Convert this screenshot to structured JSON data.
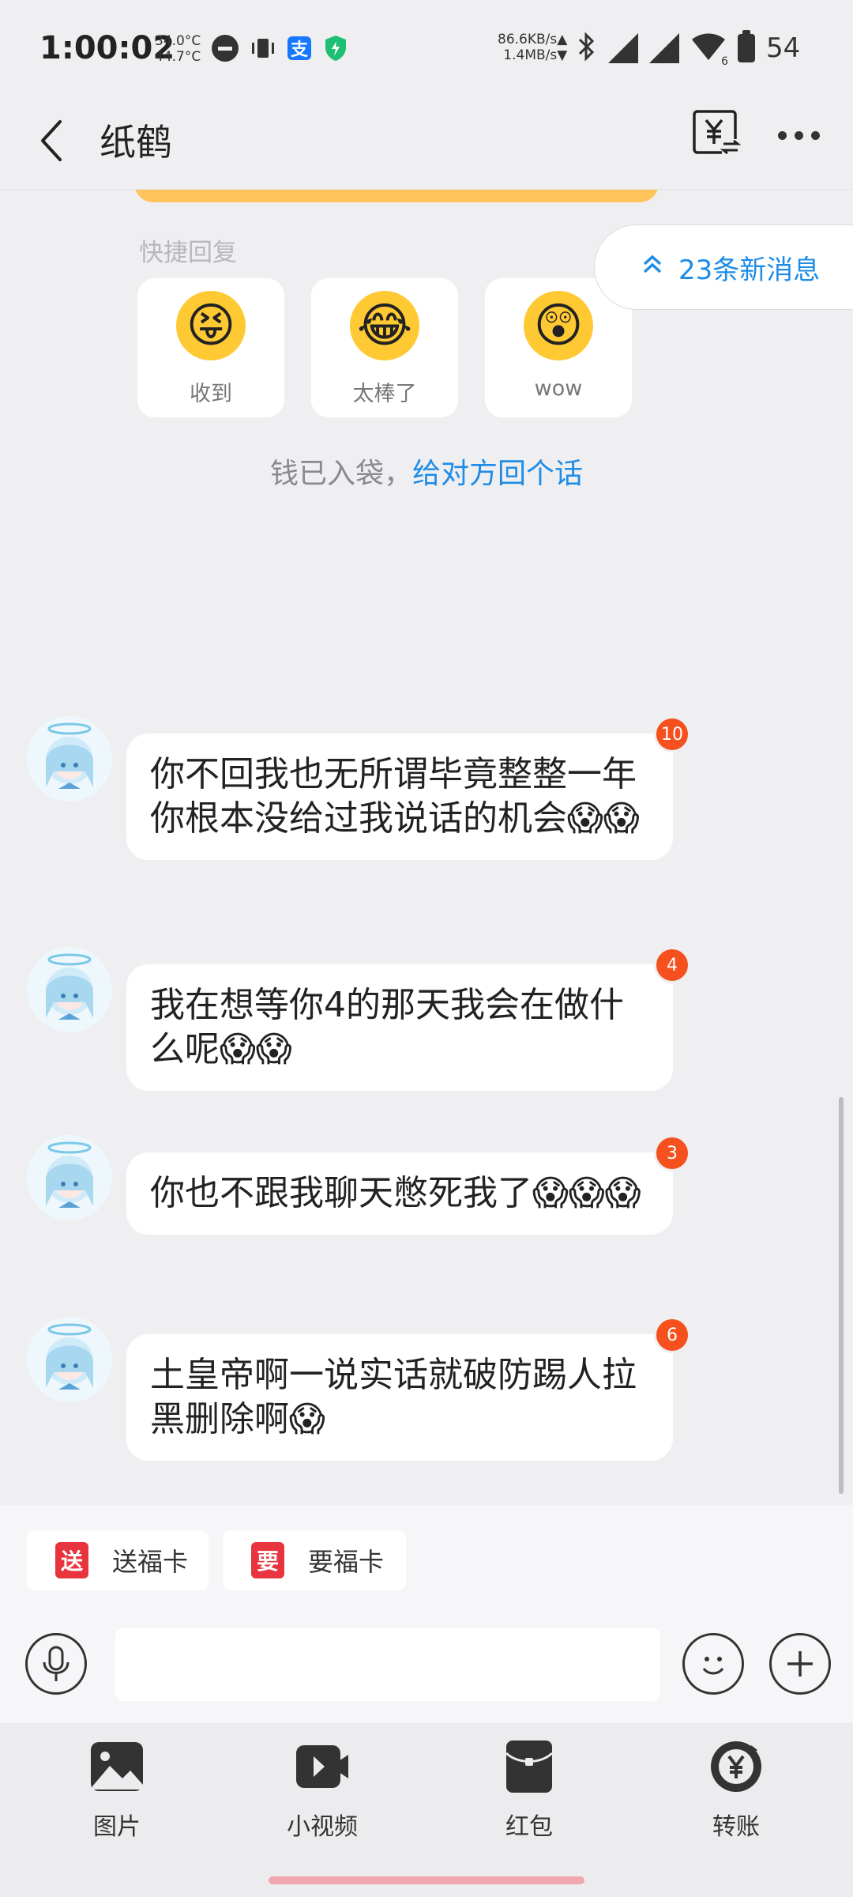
{
  "status_bar": {
    "time": "1:00:02",
    "temp_1": "34.0°C",
    "temp_2": "44.7°C",
    "alipay_label": "支",
    "net_up": "86.6KB/s▲",
    "net_down": "1.4MB/s▼",
    "battery": "54",
    "wifi_num": "6"
  },
  "header": {
    "title": "纸鹤"
  },
  "quick_reply": {
    "label": "快捷回复",
    "items": [
      {
        "emoji": "😝",
        "label": "收到"
      },
      {
        "emoji": "😂",
        "label": "太棒了"
      },
      {
        "emoji": "😲",
        "label": "wow"
      }
    ]
  },
  "new_messages": {
    "text": "23条新消息"
  },
  "money_note": {
    "prefix": "钱已入袋，",
    "link": "给对方回个话"
  },
  "messages": [
    {
      "text": "你不回我也无所谓毕竟整整一年你根本没给过我说话的机会😱😱",
      "badge": "10"
    },
    {
      "text": "我在想等你4的那天我会在做什么呢😱😱",
      "badge": "4"
    },
    {
      "text": "你也不跟我聊天憋死我了😱😱😱",
      "badge": "3"
    },
    {
      "text": "土皇帝啊一说实话就破防踢人拉黑删除啊😱",
      "badge": "6"
    }
  ],
  "cards": {
    "send": {
      "icon": "送",
      "label": "送福卡"
    },
    "ask": {
      "icon": "要",
      "label": "要福卡"
    }
  },
  "input": {
    "placeholder": ""
  },
  "tools": [
    {
      "label": "图片"
    },
    {
      "label": "小视频"
    },
    {
      "label": "红包"
    },
    {
      "label": "转账"
    }
  ],
  "colors": {
    "accent_blue": "#1e8ce6",
    "badge_red": "#f5501d",
    "card_red": "#e8343e",
    "orange": "#ffc45c"
  }
}
